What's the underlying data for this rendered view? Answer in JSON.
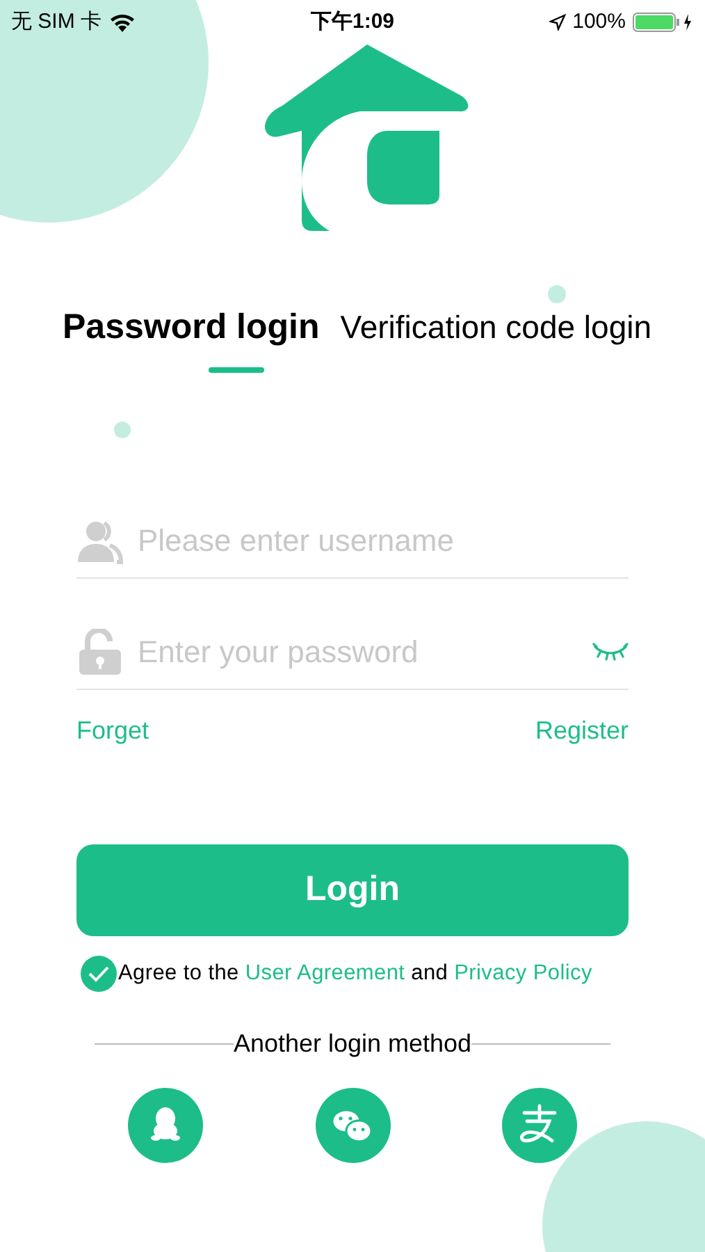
{
  "status_bar": {
    "carrier": "无 SIM 卡",
    "time": "下午1:09",
    "battery": "100%"
  },
  "tabs": [
    {
      "label": "Password login",
      "selected": true
    },
    {
      "label": "Verification code login",
      "selected": false
    }
  ],
  "fields": [
    {
      "kind": "username",
      "placeholder": "Please enter username"
    },
    {
      "kind": "password",
      "placeholder": "Enter your password"
    }
  ],
  "links": {
    "forget": "Forget",
    "register": "Register"
  },
  "login_button": "Login",
  "agreement": {
    "checked": true,
    "prefix": "Agree to the ",
    "user_agreement": "User Agreement",
    "middle": " and ",
    "privacy_policy": "Privacy Policy"
  },
  "other_login": {
    "title": "Another login method",
    "methods": [
      {
        "kind": "qq"
      },
      {
        "kind": "wechat"
      },
      {
        "kind": "alipay"
      }
    ]
  }
}
